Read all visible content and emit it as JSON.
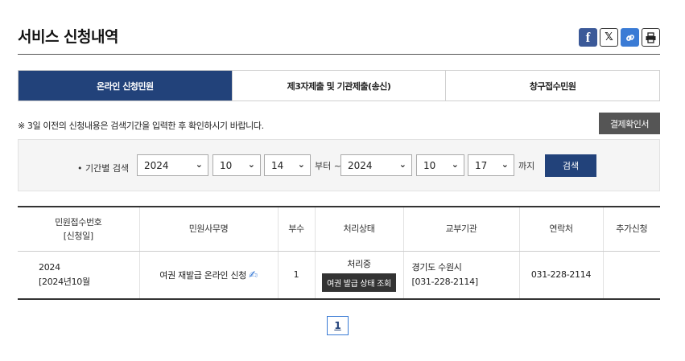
{
  "page": {
    "title": "서비스 신청내역"
  },
  "share": {
    "facebook_icon": "facebook-icon",
    "x_icon": "x-twitter-icon",
    "link_icon": "link-icon",
    "print_icon": "print-icon"
  },
  "tabs": [
    {
      "label": "온라인 신청민원",
      "active": true
    },
    {
      "label": "제3자제출 및 기관제출(송신)",
      "active": false
    },
    {
      "label": "창구접수민원",
      "active": false
    }
  ],
  "notice": "※ 3일 이전의 신청내용은 검색기간을 입력한 후 확인하시기 바랍니다.",
  "receipt_button": "결제확인서",
  "search": {
    "period_label": "• 기간별 검색",
    "from": {
      "year": "2024",
      "month": "10",
      "day": "14"
    },
    "from_suffix": "부터 ~",
    "to": {
      "year": "2024",
      "month": "10",
      "day": "17"
    },
    "to_suffix": "까지",
    "button": "검색"
  },
  "table": {
    "headers": [
      {
        "line1": "민원접수번호",
        "line2": "[신청일]"
      },
      {
        "line1": "민원사무명"
      },
      {
        "line1": "부수"
      },
      {
        "line1": "처리상태"
      },
      {
        "line1": "교부기관"
      },
      {
        "line1": "연락처"
      },
      {
        "line1": "추가신청"
      }
    ],
    "rows": [
      {
        "number": "2024",
        "date": "[2024년10월",
        "service": "여권 재발급 온라인 신청",
        "copies": "1",
        "status": "처리중",
        "status_button": "여권 발급 상태 조회",
        "org_line1": "경기도 수원시",
        "org_line2": "[031-228-2114]",
        "contact": "031-228-2114",
        "extra": ""
      }
    ]
  },
  "pagination": {
    "current": "1"
  },
  "colors": {
    "primary": "#22427a",
    "receipt": "#555555",
    "facebook": "#3b5998",
    "link": "#3a7bd5"
  }
}
